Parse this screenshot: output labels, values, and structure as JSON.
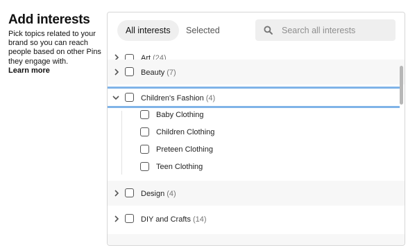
{
  "intro": {
    "title": "Add interests",
    "description": "Pick topics related to your brand so you can reach people based on other Pins they engage with.",
    "learn_more": "Learn more"
  },
  "tabs": {
    "all": "All interests",
    "selected": "Selected"
  },
  "search": {
    "placeholder": "Search all interests",
    "icon": "search-icon"
  },
  "categories": [
    {
      "label": "Art",
      "count": "(24)",
      "expanded": false
    },
    {
      "label": "Beauty",
      "count": "(7)",
      "expanded": false
    },
    {
      "label": "Children's Fashion",
      "count": "(4)",
      "expanded": true,
      "children": [
        "Baby Clothing",
        "Children Clothing",
        "Preteen Clothing",
        "Teen Clothing"
      ]
    },
    {
      "label": "Design",
      "count": "(4)",
      "expanded": false
    },
    {
      "label": "DIY and Crafts",
      "count": "(14)",
      "expanded": false
    }
  ],
  "colors": {
    "highlight": "#7fb3e8",
    "row_bg": "#f7f7f7",
    "pill_bg": "#efefef"
  }
}
